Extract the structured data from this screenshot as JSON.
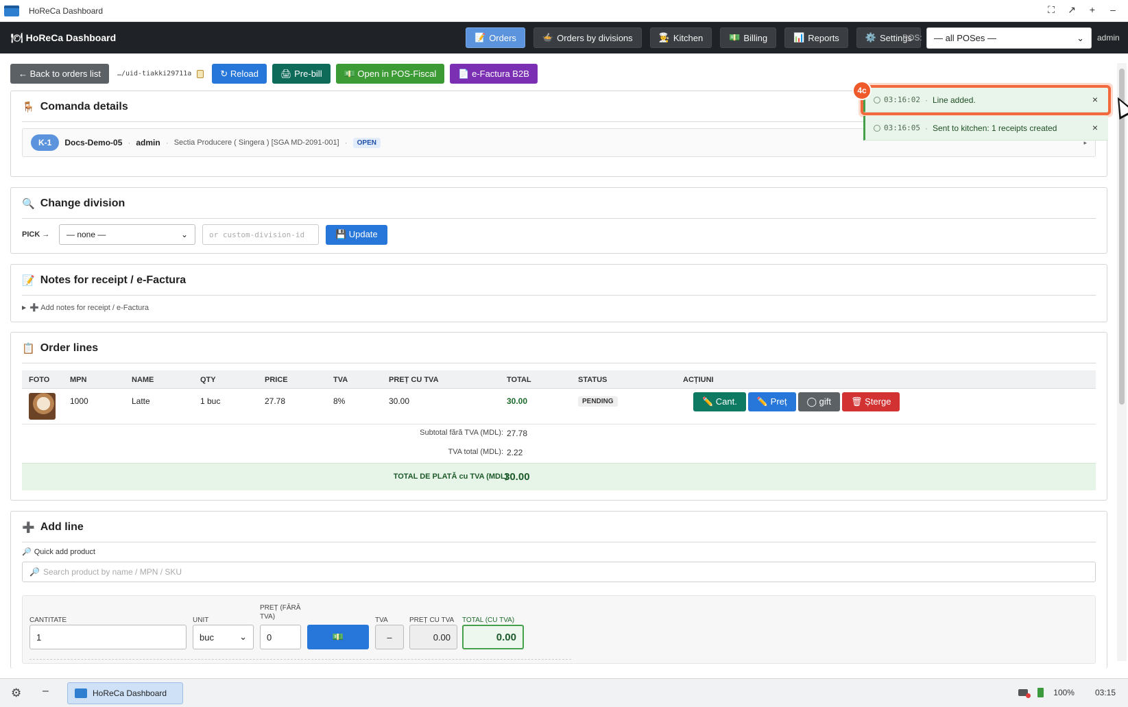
{
  "window": {
    "title": "HoReCa Dashboard",
    "controls": [
      "⛶",
      "↗",
      "+",
      "–"
    ]
  },
  "nav": {
    "brand": "🍽 HoReCa Dashboard",
    "items": [
      {
        "icon": "📝",
        "label": "Orders",
        "active": true
      },
      {
        "icon": "🍲",
        "label": "Orders by divisions"
      },
      {
        "icon": "🧑‍🍳",
        "label": "Kitchen"
      },
      {
        "icon": "💵",
        "label": "Billing"
      },
      {
        "icon": "📊",
        "label": "Reports"
      },
      {
        "icon": "⚙️",
        "label": "Settings"
      }
    ],
    "pos_label": "POS:",
    "pos_value": "— all POSes —",
    "user": "admin"
  },
  "toolbar": {
    "back": "← Back to orders list",
    "uid": "…/uid-tiakki29711a",
    "reload": "↻ Reload",
    "prebill": "🖨 Pre-bill",
    "posfiscal": "💵 Open in POS-Fiscal",
    "efactura": "📄 e-Factura B2B"
  },
  "details": {
    "title": "Comanda details",
    "badge": "K-1",
    "table": "Docs-Demo-05",
    "user": "admin",
    "division": "Sectia Producere ( Singera ) [SGA MD-2091-001]",
    "status": "OPEN",
    "caret": "▸"
  },
  "division": {
    "title": "Change division",
    "pick_label": "PICK →",
    "select_value": "— none —",
    "custom_placeholder": "or custom-division-id",
    "update": "💾 Update"
  },
  "notes": {
    "title": "Notes for receipt / e-Factura",
    "toggle": "➕ Add notes for receipt / e-Factura"
  },
  "order_lines": {
    "title": "Order lines",
    "columns": [
      "FOTO",
      "MPN",
      "NAME",
      "QTY",
      "PRICE",
      "TVA",
      "PREȚ CU TVA",
      "TOTAL",
      "STATUS",
      "ACȚIUNI"
    ],
    "rows": [
      {
        "mpn": "1000",
        "name": "Latte",
        "qty": "1 buc",
        "price": "27.78",
        "tva": "8%",
        "price_tva": "30.00",
        "total": "30.00",
        "status": "PENDING"
      }
    ],
    "actions": {
      "cant": "✏️ Cant.",
      "pret": "✏️ Preț",
      "gift": "◯ gift",
      "sterge": "🗑 Șterge"
    },
    "subtotal_label": "Subtotal fără TVA (MDL):",
    "subtotal": "27.78",
    "tva_label": "TVA total (MDL):",
    "tva_total": "2.22",
    "total_label": "TOTAL DE PLATĂ cu TVA (MDL):",
    "total": "30.00"
  },
  "add_line": {
    "title": "Add line",
    "quick_label": "Quick add product",
    "search_placeholder": "Search product by name / MPN / SKU",
    "cantitate_label": "CANTITATE",
    "cantitate": "1",
    "unit_label": "UNIT",
    "unit": "buc",
    "pret_label": "PREȚ (FĂRĂ TVA)",
    "pret": "0",
    "money_btn": "💵",
    "tva_label": "TVA",
    "tva": "–",
    "pret_tva_label": "PREȚ CU TVA",
    "pret_tva": "0.00",
    "total_label": "TOTAL (CU TVA)",
    "total": "0.00"
  },
  "toasts": [
    {
      "time": "03:16:02",
      "text": "Line added.",
      "close": "×"
    },
    {
      "time": "03:16:05",
      "text": "Sent to kitchen: 1 receipts created",
      "close": "×"
    }
  ],
  "step_badge": "4c",
  "taskbar": {
    "task": "HoReCa Dashboard",
    "battery": "100%",
    "clock": "03:15"
  },
  "colors": {
    "accent": "#2677d9",
    "nav_bg": "#1f2226",
    "success": "#46a04b",
    "danger": "#d23232",
    "highlight": "#f26a3b"
  }
}
